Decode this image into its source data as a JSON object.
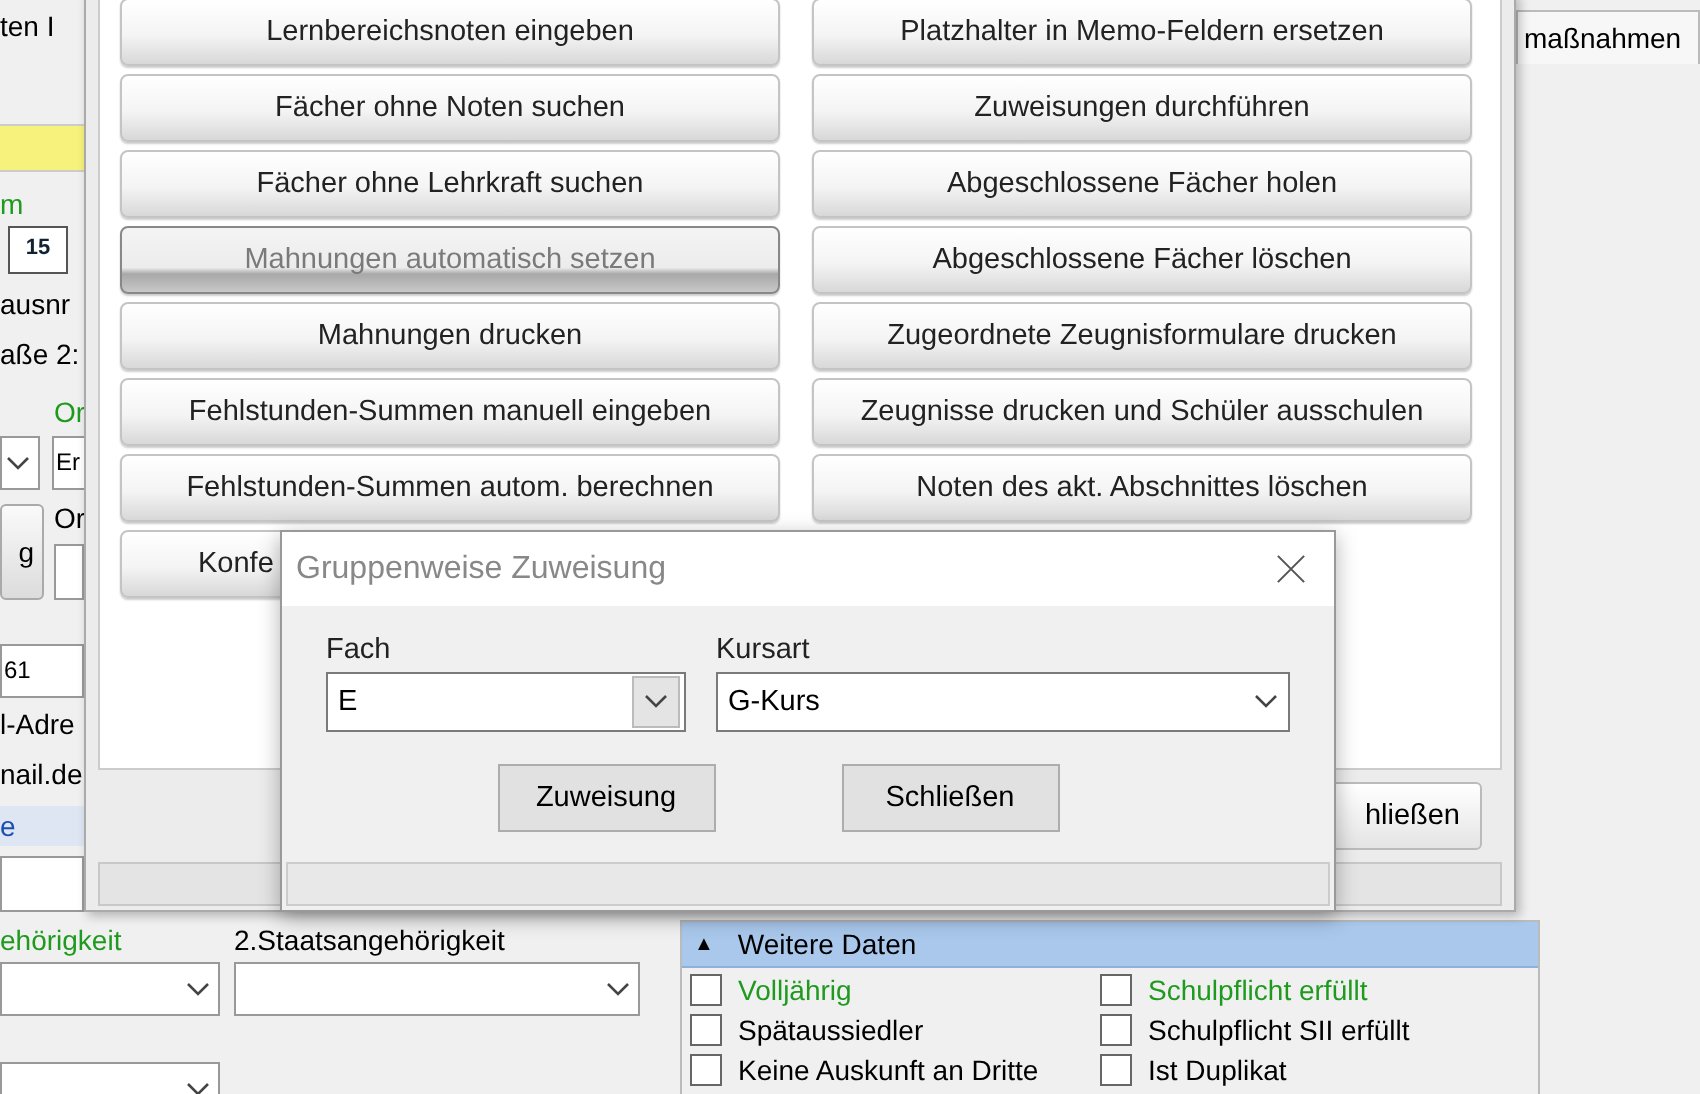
{
  "main_window": {
    "tab": "maßnahmen",
    "left_strip": [
      {
        "kind": "text",
        "text": "ten I"
      },
      {
        "kind": "highlight"
      },
      {
        "kind": "label",
        "text": "m",
        "color": "#1f9a1f"
      },
      {
        "kind": "date",
        "text": "15"
      },
      {
        "kind": "text",
        "text": "ausnr"
      },
      {
        "kind": "text",
        "text": "aße 2:"
      },
      {
        "kind": "label",
        "text": "Or",
        "color": "#1f9a1f"
      },
      {
        "kind": "combo"
      },
      {
        "kind": "field",
        "text": "Er"
      },
      {
        "kind": "button",
        "text": "g"
      },
      {
        "kind": "label",
        "text": "Or",
        "color": "#000000"
      },
      {
        "kind": "field"
      },
      {
        "kind": "field",
        "text": "61"
      },
      {
        "kind": "text",
        "text": "l-Adre"
      },
      {
        "kind": "text",
        "text": "nail.de"
      },
      {
        "kind": "band",
        "text": "e"
      },
      {
        "kind": "field"
      }
    ],
    "nationality": [
      {
        "label": "ehörigkeit",
        "color": "#1f9a1f"
      },
      {
        "label": "2.Staatsangehörigkeit",
        "color": "#000000"
      }
    ],
    "more_data": {
      "toggle": "▲",
      "title": "Weitere Daten",
      "expanded": true,
      "checkboxes": [
        {
          "label": "Volljährig",
          "checked": false,
          "color": "#1f9a1f"
        },
        {
          "label": "Schulpflicht erfüllt",
          "checked": false,
          "color": "#1f9a1f"
        },
        {
          "label": "Spätaussiedler",
          "checked": false,
          "color": "#000000"
        },
        {
          "label": "Schulpflicht SII erfüllt",
          "checked": false,
          "color": "#000000"
        },
        {
          "label": "Keine Auskunft an Dritte",
          "checked": false,
          "color": "#000000"
        },
        {
          "label": "Ist Duplikat",
          "checked": false,
          "color": "#000000"
        }
      ]
    }
  },
  "tools_window": {
    "buttons": [
      {
        "label": "Lernbereichsnoten eingeben",
        "disabled": false
      },
      {
        "label": "Platzhalter in Memo-Feldern ersetzen",
        "disabled": false
      },
      {
        "label": "Fächer ohne Noten suchen",
        "disabled": false
      },
      {
        "label": "Zuweisungen durchführen",
        "disabled": false
      },
      {
        "label": "Fächer ohne Lehrkraft suchen",
        "disabled": false
      },
      {
        "label": "Abgeschlossene Fächer holen",
        "disabled": false
      },
      {
        "label": "Mahnungen automatisch setzen",
        "disabled": true
      },
      {
        "label": "Abgeschlossene Fächer löschen",
        "disabled": false
      },
      {
        "label": "Mahnungen drucken",
        "disabled": false
      },
      {
        "label": "Zugeordnete Zeugnisformulare drucken",
        "disabled": false
      },
      {
        "label": "Fehlstunden-Summen manuell eingeben",
        "disabled": false
      },
      {
        "label": "Zeugnisse drucken und Schüler ausschulen",
        "disabled": false
      },
      {
        "label": "Fehlstunden-Summen autom. berechnen",
        "disabled": false
      },
      {
        "label": "Noten des akt. Abschnittes löschen",
        "disabled": false
      },
      {
        "label": "Konfe",
        "disabled": false
      }
    ],
    "close_button": "hließen"
  },
  "dialog": {
    "title": "Gruppenweise Zuweisung",
    "fields": [
      {
        "label": "Fach",
        "value": "E",
        "kind": "boxed"
      },
      {
        "label": "Kursart",
        "value": "G-Kurs",
        "kind": "plain"
      }
    ],
    "buttons": [
      "Zuweisung",
      "Schließen"
    ]
  }
}
